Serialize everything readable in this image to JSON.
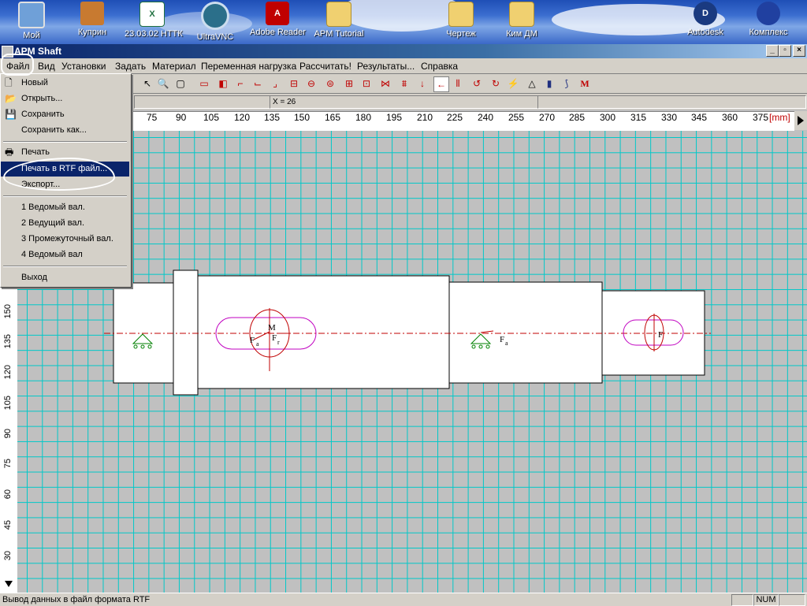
{
  "desktop": {
    "icons": [
      {
        "label": "Мой",
        "icon": "my-computer-icon"
      },
      {
        "label": "Куприн",
        "icon": "briefcase-icon"
      },
      {
        "label": "23.03.02 НТТК",
        "icon": "excel-document-icon"
      },
      {
        "label": "UltraVNC",
        "icon": "eye-icon"
      },
      {
        "label": "Adobe Reader",
        "icon": "adobe-reader-icon"
      },
      {
        "label": "APM Tutorial",
        "icon": "folder-icon"
      },
      {
        "label": "Чертеж",
        "icon": "folder-icon"
      },
      {
        "label": "Ким ДМ",
        "icon": "folder-icon"
      },
      {
        "label": "Autodesk",
        "icon": "autodesk-revit-icon"
      },
      {
        "label": "Комплекс",
        "icon": "complex-app-icon"
      }
    ]
  },
  "window": {
    "title": "APM Shaft",
    "controls": [
      "_",
      "▫",
      "×"
    ]
  },
  "menubar": {
    "items": [
      "Файл",
      "Вид",
      "Установки",
      "Задать",
      "Материал",
      "Переменная нагрузка",
      "Рассчитать!",
      "Результаты...",
      "Справка"
    ]
  },
  "file_menu": {
    "items": [
      {
        "label": "Новый",
        "icon": "new-document-icon"
      },
      {
        "label": "Открыть...",
        "icon": "open-folder-icon"
      },
      {
        "label": "Сохранить",
        "icon": "floppy-disk-icon"
      },
      {
        "label": "Сохранить как...",
        "icon": ""
      },
      {
        "label": "Печать",
        "icon": "printer-icon"
      },
      {
        "label": "Печать в RTF файл...",
        "icon": ""
      },
      {
        "label": "Экспорт...",
        "icon": ""
      },
      {
        "label": "1 Ведомый вал.",
        "icon": ""
      },
      {
        "label": "2 Ведущий вал.",
        "icon": ""
      },
      {
        "label": "3 Промежуточный вал.",
        "icon": ""
      },
      {
        "label": "4 Ведомый вал",
        "icon": ""
      },
      {
        "label": "Выход",
        "icon": ""
      }
    ],
    "highlighted": "Печать в RTF файл..."
  },
  "coord": {
    "x_label": "X = 26"
  },
  "ruler": {
    "unit": "[mm]",
    "h_ticks": [
      "75",
      "90",
      "105",
      "120",
      "135",
      "150",
      "165",
      "180",
      "195",
      "210",
      "225",
      "240",
      "255",
      "270",
      "285",
      "300",
      "315",
      "330",
      "345",
      "360",
      "375"
    ],
    "v_ticks": [
      "150",
      "135",
      "120",
      "105",
      "90",
      "75",
      "60",
      "45",
      "30"
    ]
  },
  "shaft_labels": {
    "fa": "F",
    "fa_sub": "a",
    "m": "M",
    "fr": "F",
    "fr_sub": "r",
    "f": "F"
  },
  "status": {
    "message": "Вывод данных в файл формата RTF",
    "num": "NUM"
  },
  "colors": {
    "accent": "#0a246a",
    "grid": "#00c8c8",
    "axis": "#c00000",
    "load": "#c000c0"
  }
}
